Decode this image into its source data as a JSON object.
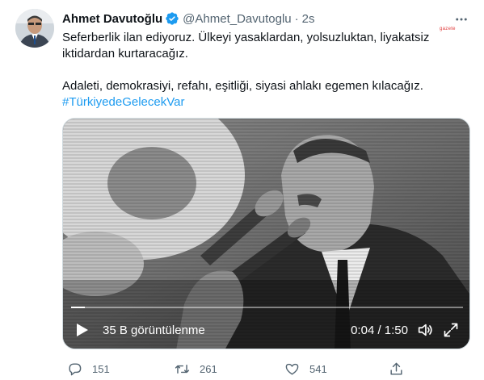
{
  "author": {
    "name": "Ahmet Davutoğlu",
    "handle": "@Ahmet_Davutoglu",
    "separator": "·",
    "time": "2s"
  },
  "watermark": "gazete",
  "tweet": {
    "line1": "Seferberlik ilan ediyoruz. Ülkeyi yasaklardan, yolsuzluktan, liyakatsiz",
    "line2": "iktidardan kurtaracağız.",
    "line3": "Adaleti, demokrasiyi, refahı, eşitliği, siyasi ahlakı egemen kılacağız.",
    "hashtag": "#TürkiyedeGelecekVar"
  },
  "video": {
    "views": "35 B görüntülenme",
    "timecode": "0:04 / 1:50",
    "progress": 0.036
  },
  "actions": {
    "replies": "151",
    "retweets": "261",
    "likes": "541"
  },
  "colors": {
    "accent": "#1d9bf0",
    "muted": "#536471",
    "text": "#0f1419"
  }
}
